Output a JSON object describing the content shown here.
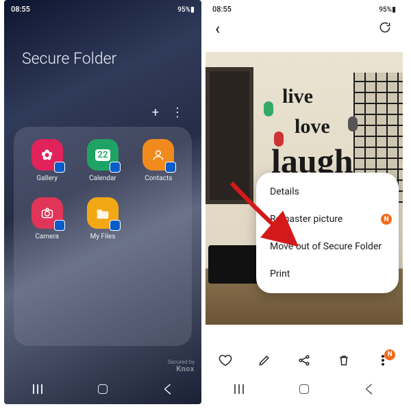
{
  "status": {
    "time": "08:55",
    "battery": "95%",
    "left_extra": "✿ ◧ ▸",
    "right_extra": "⟟ ⟟ ▾ ⌄ ✉"
  },
  "left": {
    "title": "Secure Folder",
    "actions": {
      "add": "+",
      "more": "⋮"
    },
    "apps": [
      {
        "label": "Gallery",
        "icon": "flower"
      },
      {
        "label": "Calendar",
        "icon": "cal22"
      },
      {
        "label": "Contacts",
        "icon": "person"
      },
      {
        "label": "Camera",
        "icon": "camera"
      },
      {
        "label": "My Files",
        "icon": "folder"
      }
    ],
    "knox_top": "Secured by",
    "knox_bottom": "Knox",
    "cal_day": "22"
  },
  "right": {
    "back": "‹",
    "sync": "↻",
    "photo_words": {
      "w1": "live",
      "w2": "love",
      "w3": "laugh"
    },
    "menu": [
      {
        "label": "Details",
        "badge": ""
      },
      {
        "label": "Remaster picture",
        "badge": "N"
      },
      {
        "label": "Move out of Secure Folder",
        "badge": ""
      },
      {
        "label": "Print",
        "badge": ""
      }
    ],
    "toolbar_badge": "N"
  },
  "nav": {
    "recent": "|||",
    "home": "○",
    "back": "<"
  }
}
